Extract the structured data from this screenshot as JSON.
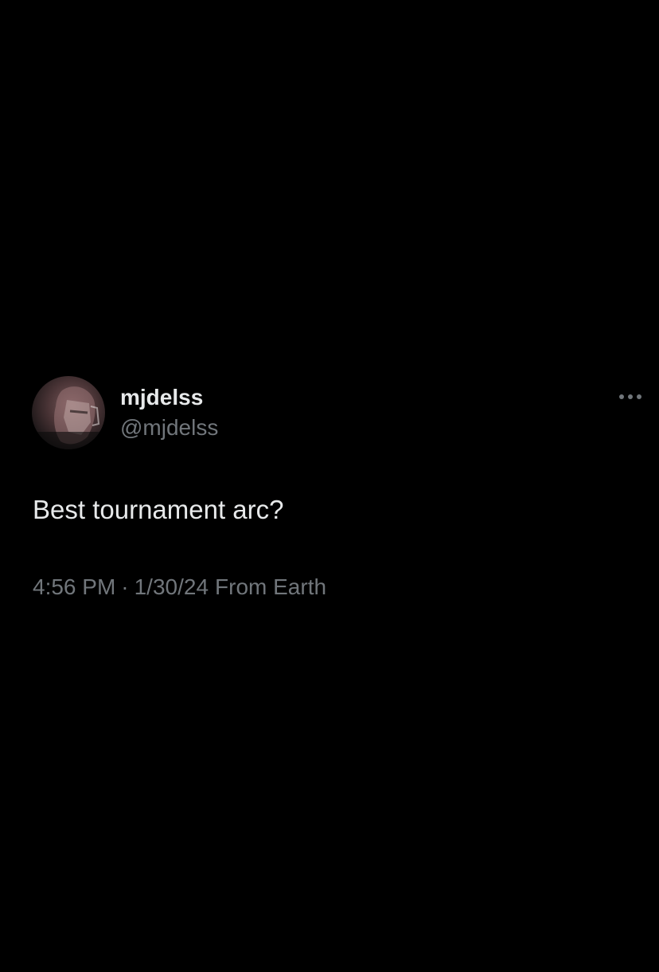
{
  "author": {
    "display_name": "mjdelss",
    "handle": "@mjdelss",
    "avatar_icon": "profile-avatar"
  },
  "tweet": {
    "text": "Best tournament arc?",
    "time": "4:56 PM",
    "separator": "·",
    "date": "1/30/24",
    "source": "From Earth"
  },
  "actions": {
    "more_icon": "more-horizontal-icon"
  },
  "colors": {
    "background": "#000000",
    "primary_text": "#e7e9ea",
    "secondary_text": "#71767b"
  }
}
